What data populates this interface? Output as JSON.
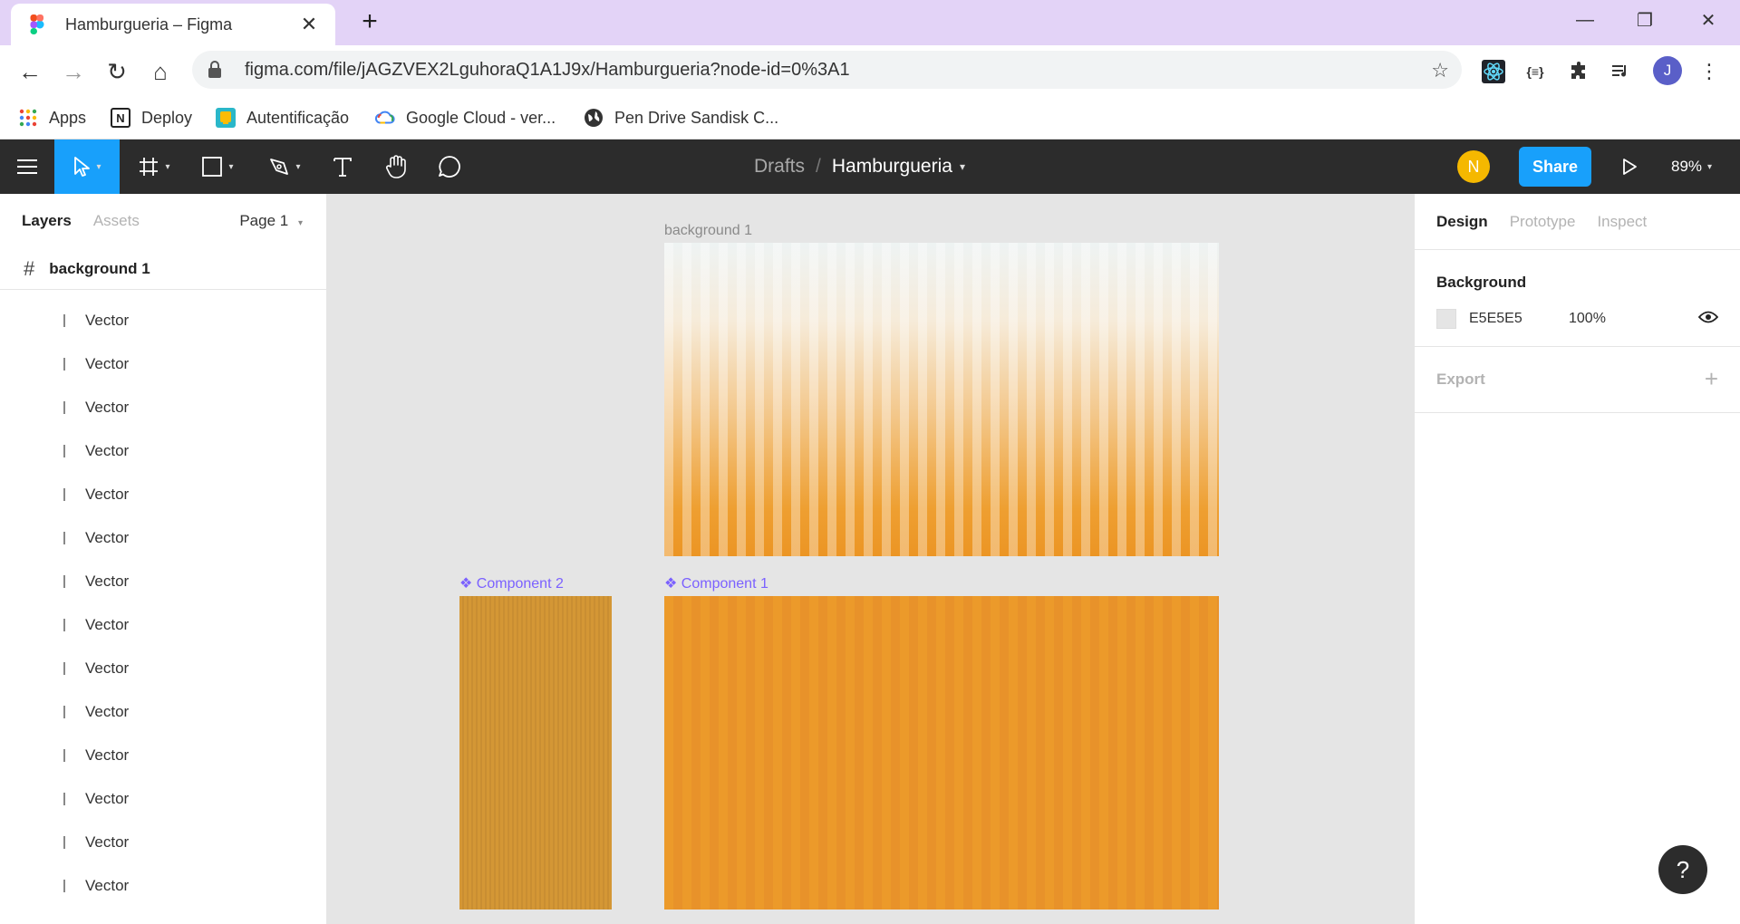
{
  "browser": {
    "tab_title": "Hamburgueria – Figma",
    "url": "figma.com/file/jAGZVEX2LguhoraQ1A1J9x/Hamburgueria?node-id=0%3A1",
    "bookmarks": [
      {
        "label": "Apps",
        "icon": "apps-grid-icon"
      },
      {
        "label": "Deploy",
        "icon": "notion-icon"
      },
      {
        "label": "Autentificação",
        "icon": "keep-icon"
      },
      {
        "label": "Google Cloud - ver...",
        "icon": "google-cloud-icon"
      },
      {
        "label": "Pen Drive Sandisk C...",
        "icon": "globe-icon"
      }
    ],
    "profile_initial": "J"
  },
  "figma_toolbar": {
    "crumb_drafts": "Drafts",
    "crumb_sep": "/",
    "file_name": "Hamburgueria",
    "user_initial": "N",
    "share_label": "Share",
    "zoom": "89%"
  },
  "left_panel": {
    "tab_layers": "Layers",
    "tab_assets": "Assets",
    "page": "Page 1",
    "frame_name": "background 1",
    "layers": [
      "Vector",
      "Vector",
      "Vector",
      "Vector",
      "Vector",
      "Vector",
      "Vector",
      "Vector",
      "Vector",
      "Vector",
      "Vector",
      "Vector",
      "Vector",
      "Vector"
    ]
  },
  "canvas": {
    "frame_label": "background 1",
    "component1_label": "❖ Component 1",
    "component2_label": "❖ Component 2",
    "colors": {
      "canvas_bg": "#E5E5E5",
      "orange": "#EC9524",
      "component_purple": "#7B61FF"
    }
  },
  "right_panel": {
    "tab_design": "Design",
    "tab_prototype": "Prototype",
    "tab_inspect": "Inspect",
    "background_title": "Background",
    "background_hex": "E5E5E5",
    "background_opacity": "100%",
    "export_title": "Export",
    "help_label": "?"
  }
}
